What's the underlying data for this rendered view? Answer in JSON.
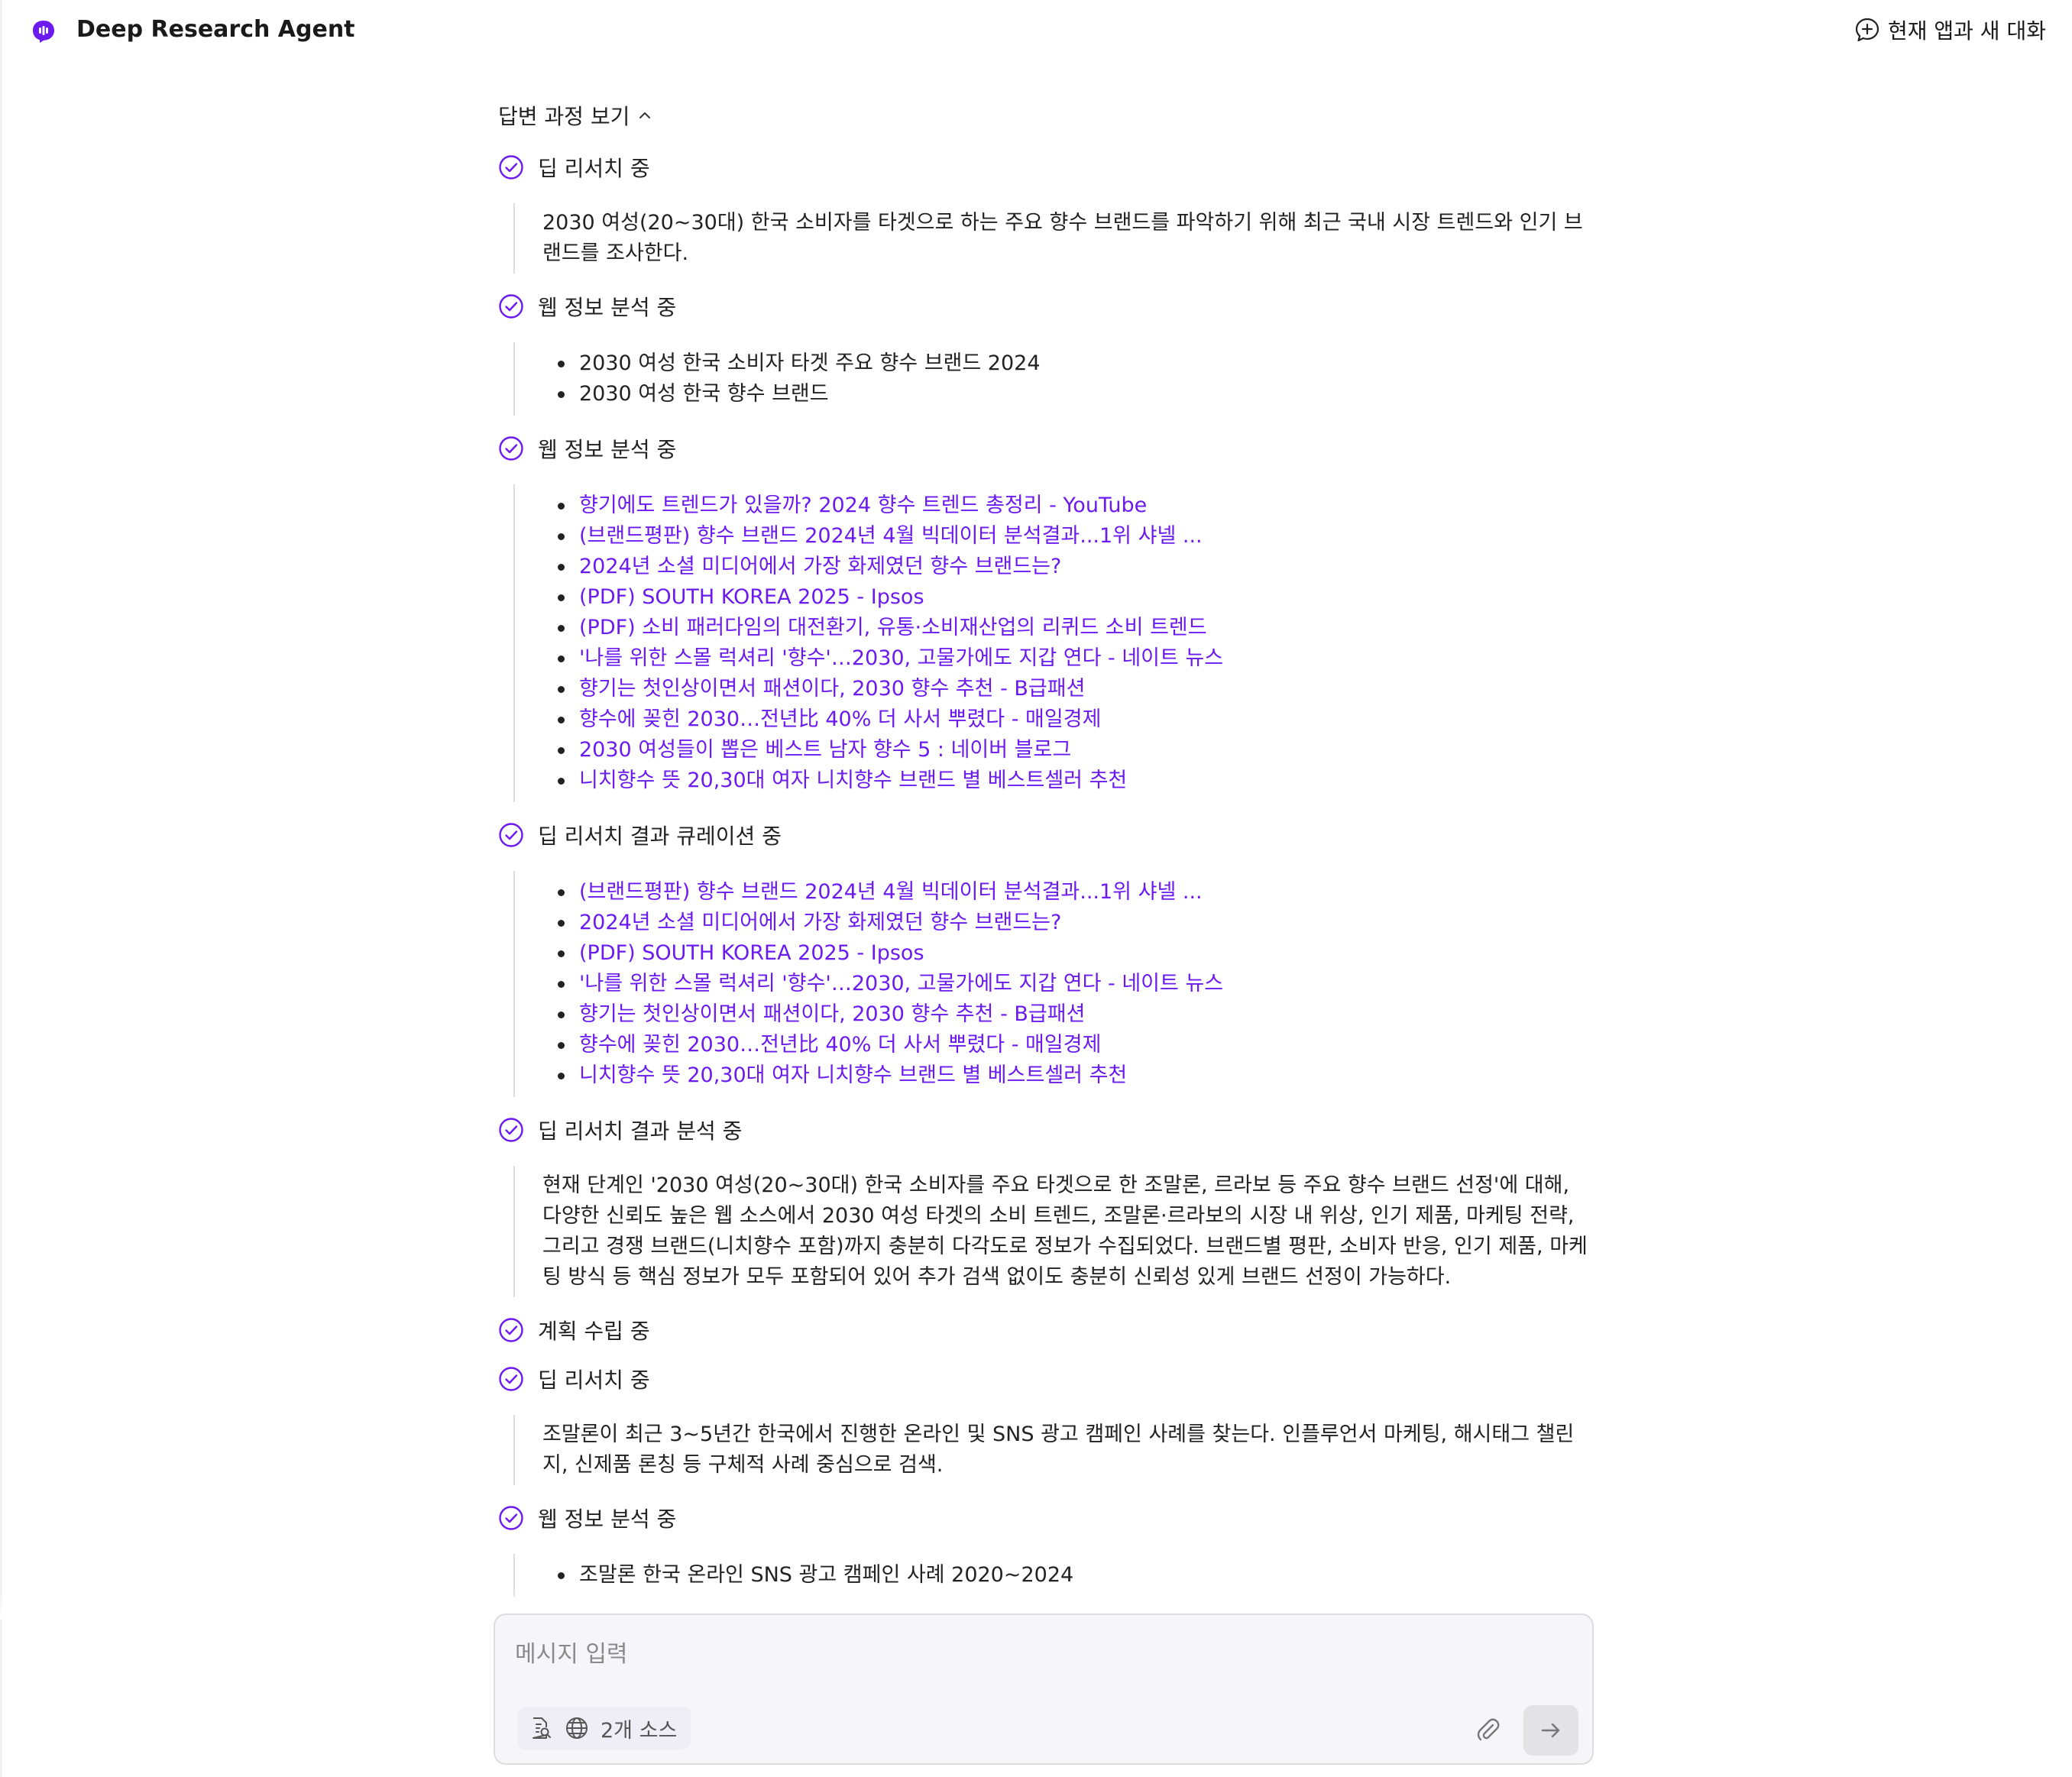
{
  "header": {
    "app_title": "Deep Research Agent",
    "new_chat_label": "현재 앱과 새 대화"
  },
  "toggle": {
    "label": "답변 과정 보기"
  },
  "steps": [
    {
      "title": "딥 리서치 중",
      "text": "2030 여성(20~30대) 한국 소비자를 타겟으로 하는 주요 향수 브랜드를 파악하기 위해 최근 국내 시장 트렌드와 인기 브랜드를 조사한다."
    },
    {
      "title": "웹 정보 분석 중",
      "items": [
        "2030 여성 한국 소비자 타겟 주요 향수 브랜드 2024",
        "2030 여성 한국 향수 브랜드"
      ]
    },
    {
      "title": "웹 정보 분석 중",
      "items": [
        "향기에도 트렌드가 있을까? 2024 향수 트렌드 총정리 - YouTube",
        "(브랜드평판) 향수 브랜드 2024년 4월 빅데이터 분석결과...1위 샤넬 ...",
        "2024년 소셜 미디어에서 가장 화제였던 향수 브랜드는?",
        "(PDF) SOUTH KOREA 2025 - Ipsos",
        "(PDF) 소비 패러다임의 대전환기, 유통·소비재산업의 리퀴드 소비 트렌드",
        "'나를 위한 스몰 럭셔리 '향수'…2030, 고물가에도 지갑 연다 - 네이트 뉴스",
        "향기는 첫인상이면서 패션이다, 2030 향수 추천 - B급패션",
        "향수에 꽂힌 2030…전년比 40% 더 사서 뿌렸다 - 매일경제",
        "2030 여성들이 뽑은 베스트 남자 향수 5 : 네이버 블로그",
        "니치향수 뜻 20,30대 여자 니치향수 브랜드 별 베스트셀러 추천"
      ]
    },
    {
      "title": "딥 리서치 결과 큐레이션 중",
      "items": [
        "(브랜드평판) 향수 브랜드 2024년 4월 빅데이터 분석결과...1위 샤넬 ...",
        "2024년 소셜 미디어에서 가장 화제였던 향수 브랜드는?",
        "(PDF) SOUTH KOREA 2025 - Ipsos",
        "'나를 위한 스몰 럭셔리 '향수'…2030, 고물가에도 지갑 연다 - 네이트 뉴스",
        "향기는 첫인상이면서 패션이다, 2030 향수 추천 - B급패션",
        "향수에 꽂힌 2030…전년比 40% 더 사서 뿌렸다 - 매일경제",
        "니치향수 뜻 20,30대 여자 니치향수 브랜드 별 베스트셀러 추천"
      ]
    },
    {
      "title": "딥 리서치 결과 분석 중",
      "text": "현재 단계인 '2030 여성(20~30대) 한국 소비자를 주요 타겟으로 한 조말론, 르라보 등 주요 향수 브랜드 선정'에 대해, 다양한 신뢰도 높은 웹 소스에서 2030 여성 타겟의 소비 트렌드, 조말론·르라보의 시장 내 위상, 인기 제품, 마케팅 전략, 그리고 경쟁 브랜드(니치향수 포함)까지 충분히 다각도로 정보가 수집되었다. 브랜드별 평판, 소비자 반응, 인기 제품, 마케팅 방식 등 핵심 정보가 모두 포함되어 있어 추가 검색 없이도 충분히 신뢰성 있게 브랜드 선정이 가능하다."
    },
    {
      "title": "계획 수립 중"
    },
    {
      "title": "딥 리서치 중",
      "text": "조말론이 최근 3~5년간 한국에서 진행한 온라인 및 SNS 광고 캠페인 사례를 찾는다. 인플루언서 마케팅, 해시태그 챌린지, 신제품 론칭 등 구체적 사례 중심으로 검색."
    },
    {
      "title": "웹 정보 분석 중",
      "items": [
        "조말론 한국 온라인 SNS 광고 캠페인 사례 2020~2024"
      ]
    }
  ],
  "composer": {
    "placeholder": "메시지 입력",
    "source_label": "2개 소스"
  },
  "colors": {
    "accent": "#6b1bf0",
    "text": "#222222",
    "rule": "#dcdcdc",
    "composer_bg": "#f6f5fa"
  }
}
